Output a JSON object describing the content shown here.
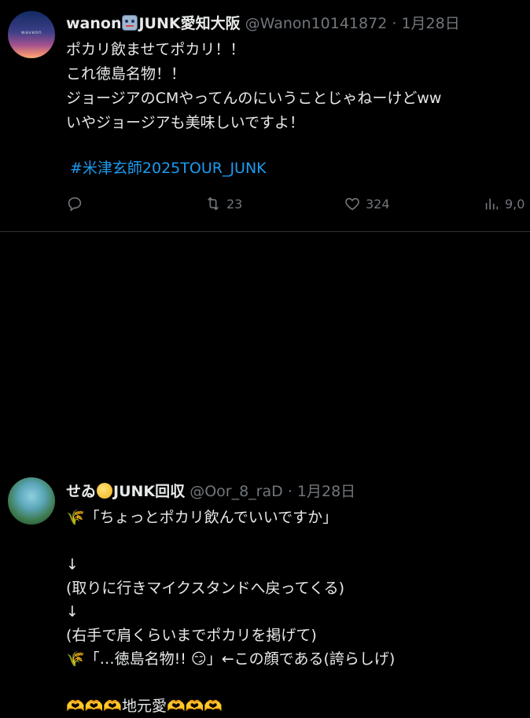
{
  "tweets": [
    {
      "display_name": "wanon",
      "display_name_suffix": "JUNK愛知大阪",
      "handle": "@Wanon10141872",
      "separator": "·",
      "date": "1月28日",
      "text": "ポカリ飲ませてポカリ！！\nこれ徳島名物！！\nジョージアのCMやってんのにいうことじゃねーけどww\nいやジョージアも美味しいですよ！",
      "hashtag": "#米津玄師2025TOUR_JUNK",
      "retweets": "23",
      "likes": "324",
      "views": "9,0",
      "avatar_text": "waveon",
      "name_emoji": "robot-face",
      "action_icons": [
        "reply-icon",
        "retweet-icon",
        "like-icon",
        "views-icon"
      ]
    },
    {
      "display_name": "せゐ",
      "display_name_suffix": "JUNK回収",
      "handle": "@Oor_8_raD",
      "separator": "·",
      "date": "1月28日",
      "text": "🌾「ちょっとポカリ飲んでいいですか」\n\n↓\n(取りに行きマイクスタンドへ戻ってくる)\n↓\n(右手で肩くらいまでポカリを掲げて)\n🌾「…徳島名物!! 😏」←この顔である(誇らしげ)\n\n🫶🫶🫶地元愛🫶🫶🫶",
      "name_emoji": "moon-face"
    }
  ],
  "colors": {
    "background": "#000000",
    "text": "#e7e9ea",
    "secondary": "#71767b",
    "link": "#1d9bf0",
    "divider": "#2f3336"
  }
}
